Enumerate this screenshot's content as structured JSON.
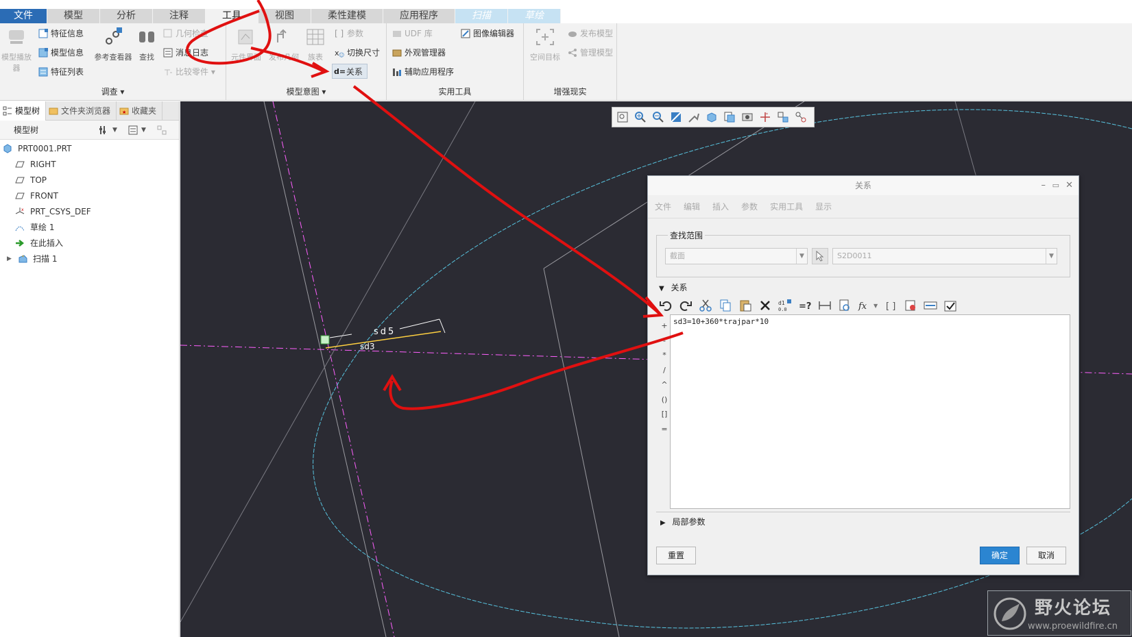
{
  "tabs": [
    "文件",
    "模型",
    "分析",
    "注释",
    "工具",
    "视图",
    "柔性建模",
    "应用程序",
    "扫描",
    "草绘"
  ],
  "ribbon": {
    "investigate": {
      "label": "调查 ▾",
      "model_player": "模型播放器",
      "feature_info": "特征信息",
      "model_info": "模型信息",
      "feature_list": "特征列表",
      "reference_viewer": "参考查看器",
      "find": "查找",
      "geom_check": "几何检查",
      "message_log": "消息日志",
      "compare_part": "比较零件 ▾"
    },
    "model_intent": {
      "label": "模型意图 ▾",
      "comp_interface": "元件界面",
      "publish_geom": "发布几何",
      "family_table": "族表",
      "params": "参数",
      "switch_dims": "切换尺寸",
      "relations": "关系"
    },
    "utilities": {
      "label": "实用工具",
      "udf_lib": "UDF 库",
      "image_editor": "图像编辑器",
      "appearance_mgr": "外观管理器",
      "aux_apps": "辅助应用程序"
    },
    "ar": {
      "label": "增强现实",
      "space_target": "空间目标",
      "publish_model": "发布模型",
      "manage_model": "管理模型"
    }
  },
  "left_panel": {
    "tabs": [
      "模型树",
      "文件夹浏览器",
      "收藏夹"
    ],
    "header": "模型树",
    "tree": [
      "PRT0001.PRT",
      "RIGHT",
      "TOP",
      "FRONT",
      "PRT_CSYS_DEF",
      "草绘 1",
      "在此插入",
      "扫描 1"
    ]
  },
  "viewport": {
    "dim_sd5": "sd5",
    "dim_sd3": "sd3"
  },
  "dialog": {
    "title": "关系",
    "menu": [
      "文件",
      "编辑",
      "插入",
      "参数",
      "实用工具",
      "显示"
    ],
    "scope_label": "查找范围",
    "scope_type": "截面",
    "scope_value": "S2D0011",
    "relations_label": "关系",
    "operators": [
      "+",
      "-",
      "*",
      "/",
      "^",
      "()",
      "[]",
      "="
    ],
    "relation_text": "sd3=10+360*trajpar*10",
    "local_params": "局部参数",
    "reset": "重置",
    "ok": "确定",
    "cancel": "取消"
  },
  "watermark": {
    "name": "野火论坛",
    "url": "www.proewildfire.cn"
  },
  "colors": {
    "file_tab": "#2b6cb5",
    "viewport_bg": "#2b2b33",
    "annotation_red": "#e01010",
    "ok_button": "#2b85d1"
  }
}
